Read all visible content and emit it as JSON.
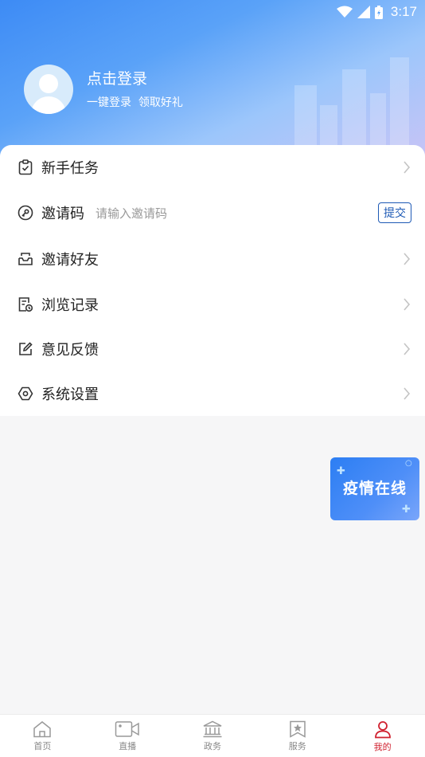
{
  "status_bar": {
    "time": "3:17"
  },
  "header": {
    "login_title": "点击登录",
    "login_subtitle": "一键登录  领取好礼"
  },
  "menu": {
    "new_tasks": "新手任务",
    "invite_code": {
      "label": "邀请码",
      "placeholder": "请输入邀请码",
      "submit": "提交"
    },
    "invite_friends": "邀请好友",
    "history": "浏览记录",
    "feedback": "意见反馈",
    "settings": "系统设置"
  },
  "floating_banner": {
    "text": "疫情在线"
  },
  "tabbar": {
    "items": [
      {
        "label": "首页",
        "icon": "home-icon"
      },
      {
        "label": "直播",
        "icon": "video-camera-icon"
      },
      {
        "label": "政务",
        "icon": "government-building-icon"
      },
      {
        "label": "服务",
        "icon": "star-bookmark-icon"
      },
      {
        "label": "我的",
        "icon": "user-icon",
        "active": true
      }
    ]
  },
  "colors": {
    "accent_blue": "#3d8bf5",
    "active_red": "#d0212f",
    "submit_blue": "#1e5ab5"
  }
}
